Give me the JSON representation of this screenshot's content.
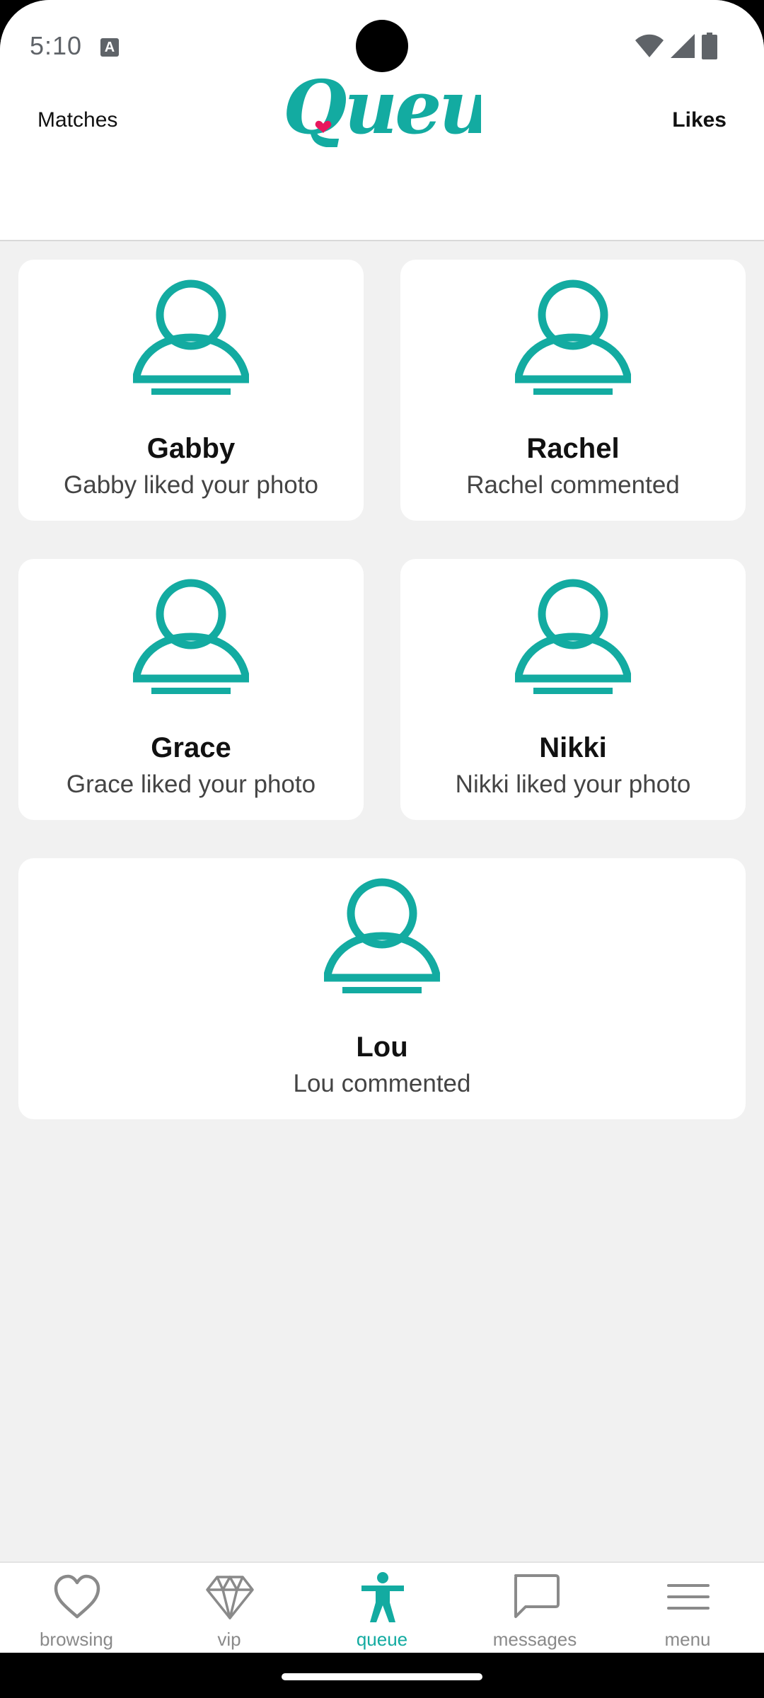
{
  "status_bar": {
    "time": "5:10",
    "notification_icon": "a-icon",
    "icons": [
      "wifi-icon",
      "signal-icon",
      "battery-icon"
    ]
  },
  "header": {
    "left_tab": "Matches",
    "right_tab": "Likes",
    "logo_text": "Queue",
    "accent_color": "#13aba1",
    "heart_color": "#e8175d"
  },
  "cards": [
    {
      "name": "Gabby",
      "activity": "Gabby liked your photo"
    },
    {
      "name": "Rachel",
      "activity": "Rachel commented"
    },
    {
      "name": "Grace",
      "activity": "Grace liked your photo"
    },
    {
      "name": "Nikki",
      "activity": "Nikki liked your photo"
    },
    {
      "name": "Lou",
      "activity": "Lou commented"
    }
  ],
  "nav": {
    "items": [
      {
        "label": "browsing",
        "icon": "heart-icon"
      },
      {
        "label": "vip",
        "icon": "diamond-icon"
      },
      {
        "label": "queue",
        "icon": "person-icon",
        "active": true
      },
      {
        "label": "messages",
        "icon": "chat-bubble-icon"
      },
      {
        "label": "menu",
        "icon": "hamburger-icon"
      }
    ]
  }
}
